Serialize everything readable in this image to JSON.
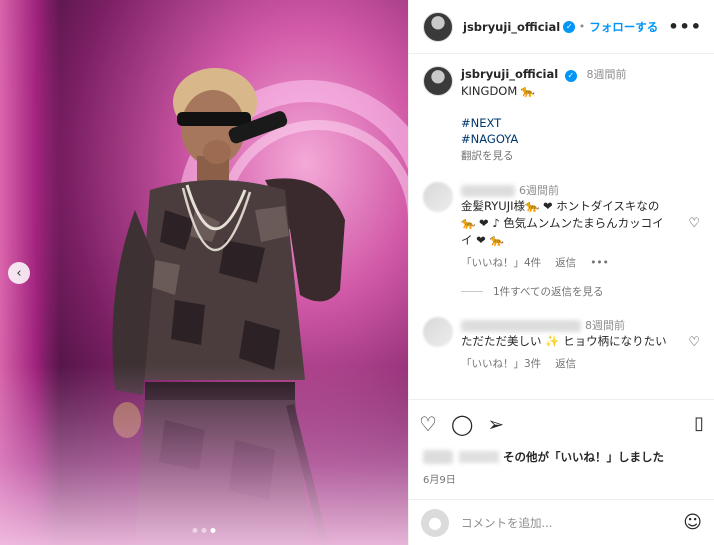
{
  "header": {
    "username": "jsbryuji_official",
    "follow_label": "フォローする",
    "more": "•••"
  },
  "caption": {
    "username": "jsbryuji_official",
    "time": "8週間前",
    "text": "KINGDOM 🐆",
    "hashtags": [
      "#NEXT",
      "#NAGOYA"
    ],
    "translate": "翻訳を見る"
  },
  "comments": [
    {
      "time": "6週間前",
      "text": "金髪RYUJI様🐆 ❤ ホントダイスキなの🐆 ❤ ♪ 色気ムンムンたまらんカッコイイ ❤ 🐆",
      "likes_label": "「いいね！」4件",
      "reply_label": "返信",
      "more": "•••"
    },
    {
      "time": "8週間前",
      "text": "ただただ美しい ✨ ヒョウ柄になりたい",
      "likes_label": "「いいね！」3件",
      "reply_label": "返信"
    }
  ],
  "replies_toggle": "1件すべての返信を見る",
  "likes_summary": "その他が「いいね！」しました",
  "date": "6月9日",
  "comment_placeholder": "コメントを追加...",
  "carousel": {
    "count": 3,
    "active": 3,
    "prev_arrow": "‹"
  }
}
